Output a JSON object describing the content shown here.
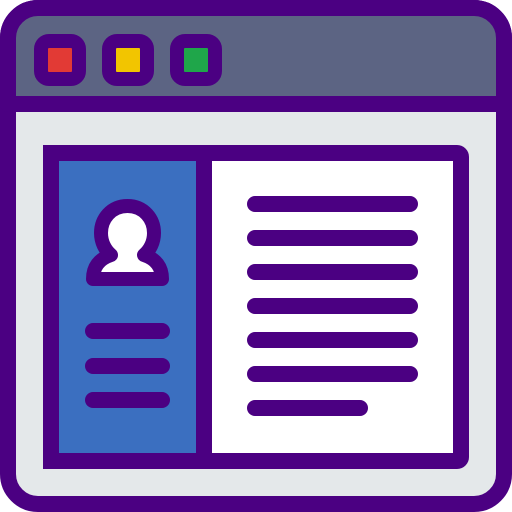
{
  "colors": {
    "outline": "#4B0082",
    "titlebar": "#5C6483",
    "window_body": "#E4E8EA",
    "panel_bg": "#FFFFFF",
    "sidebar_bg": "#3B6FC0",
    "avatar_fill": "#FFFFFF",
    "dot_close": "#E23A35",
    "dot_minimize": "#F2C500",
    "dot_maximize": "#1FA64A"
  },
  "icons": {
    "window": "browser-window-icon",
    "window_buttons": [
      "close-dot-icon",
      "minimize-dot-icon",
      "maximize-dot-icon"
    ],
    "avatar": "user-avatar-icon",
    "text_lines": "text-lines-icon"
  },
  "profile_card": {
    "sidebar_lines": 3,
    "content_lines": 7
  }
}
